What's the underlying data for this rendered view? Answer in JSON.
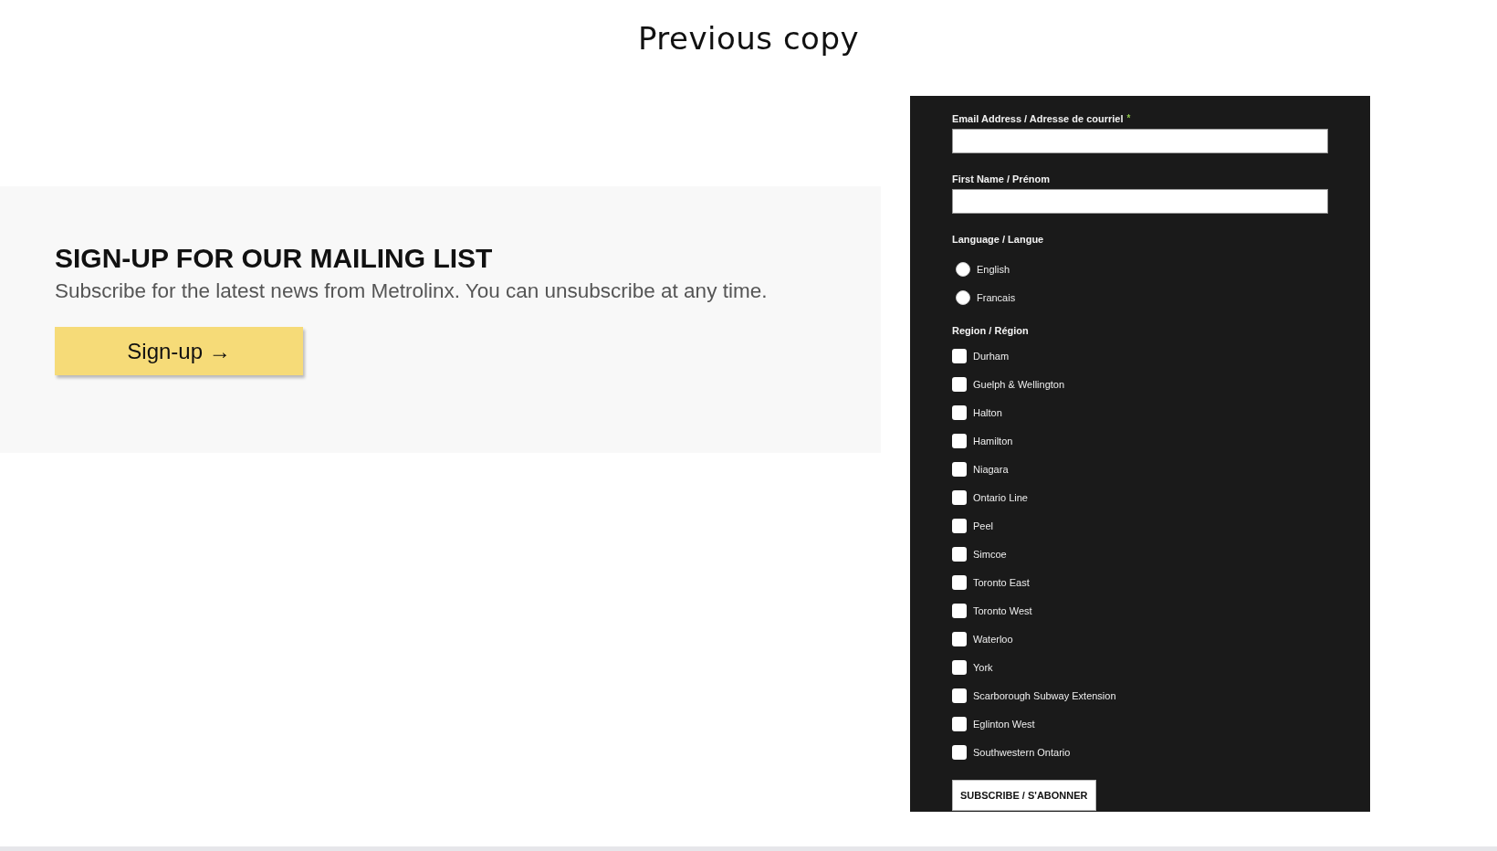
{
  "page_title": "Previous copy",
  "promo": {
    "heading": "SIGN-UP FOR OUR MAILING LIST",
    "text": "Subscribe for the latest news from Metrolinx. You can unsubscribe at any time.",
    "button": "Sign-up →"
  },
  "form": {
    "fields": [
      {
        "label": "Email Address / Adresse de courriel",
        "required_mark": "*"
      },
      {
        "label": "First Name / Prénom"
      }
    ],
    "language": {
      "label": "Language / Langue",
      "options": [
        {
          "label": "English",
          "selected": false
        },
        {
          "label": "Francais",
          "selected": false
        }
      ]
    },
    "region": {
      "label": "Region / Région",
      "options": [
        {
          "label": "Durham",
          "checked": false
        },
        {
          "label": "Guelph & Wellington",
          "checked": false
        },
        {
          "label": "Halton",
          "checked": false
        },
        {
          "label": "Hamilton",
          "checked": false
        },
        {
          "label": "Niagara",
          "checked": false
        },
        {
          "label": "Ontario Line",
          "checked": false
        },
        {
          "label": "Peel",
          "checked": false
        },
        {
          "label": "Simcoe",
          "checked": false
        },
        {
          "label": "Toronto East",
          "checked": false
        },
        {
          "label": "Toronto West",
          "checked": false
        },
        {
          "label": "Waterloo",
          "checked": false
        },
        {
          "label": "York",
          "checked": false
        },
        {
          "label": "Scarborough Subway Extension",
          "checked": false
        },
        {
          "label": "Eglinton West",
          "checked": false
        },
        {
          "label": "Southwestern Ontario",
          "checked": false
        }
      ]
    },
    "submit": "SUBSCRIBE / S'ABONNER"
  }
}
